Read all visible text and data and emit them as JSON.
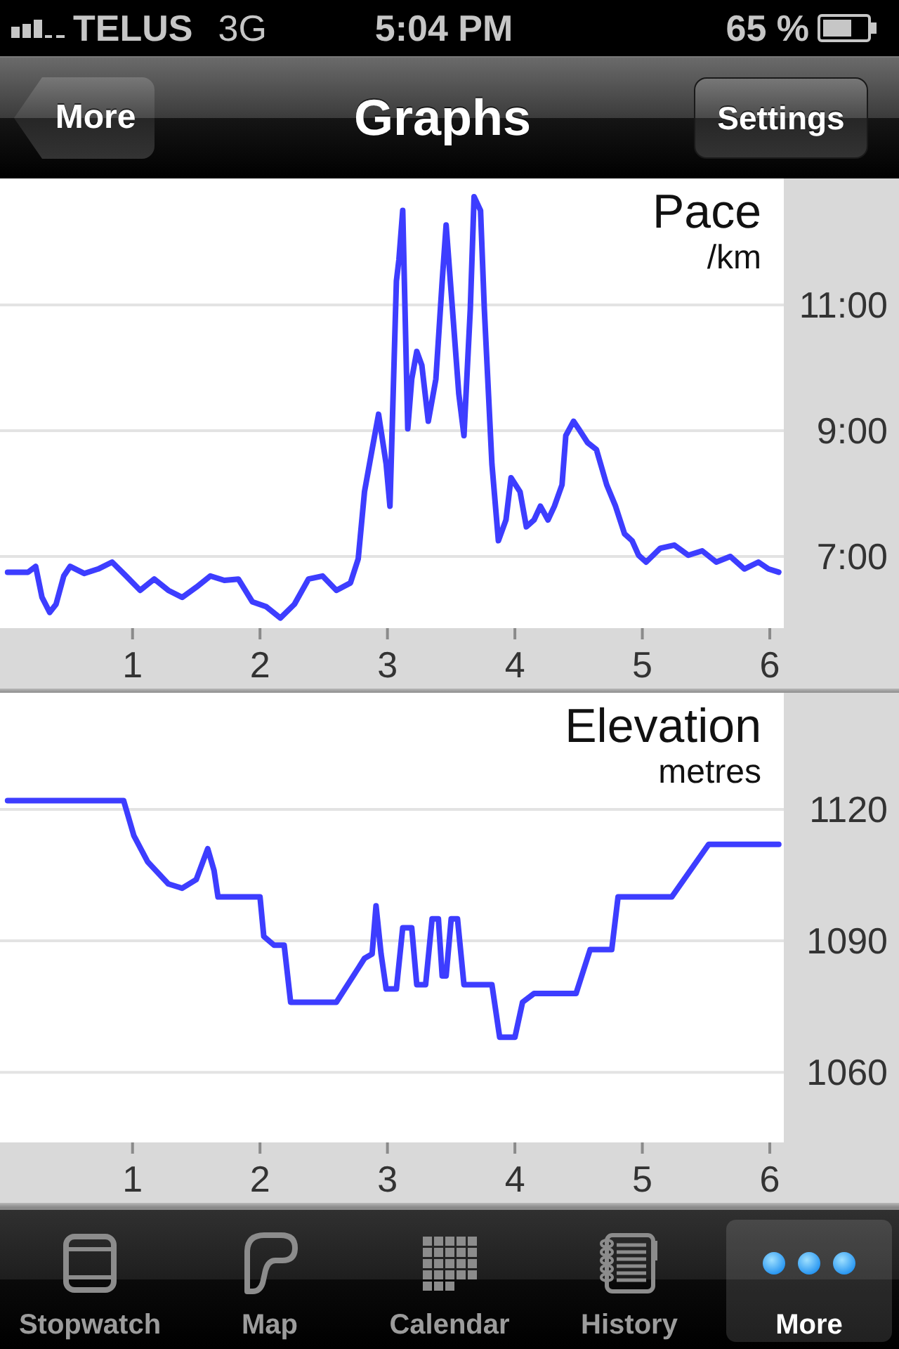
{
  "status_bar": {
    "carrier": "TELUS",
    "network": "3G",
    "time": "5:04 PM",
    "battery": "65 %"
  },
  "nav_bar": {
    "back_button": "More",
    "title": "Graphs",
    "right_button": "Settings"
  },
  "charts": [
    {
      "chart_data": {
        "type": "line",
        "title": "Pace",
        "ylabel": "/km",
        "grid": true,
        "xlim": [
          -0.04,
          6.11
        ],
        "ylim": [
          5.86,
          13.01
        ],
        "xticks": [
          1,
          2,
          3,
          4,
          5,
          6
        ],
        "yticks": [
          {
            "value": 7,
            "label": "7:00"
          },
          {
            "value": 9,
            "label": "9:00"
          },
          {
            "value": 11,
            "label": "11:00"
          }
        ],
        "x": [
          0.02,
          0.18,
          0.24,
          0.29,
          0.35,
          0.4,
          0.46,
          0.51,
          0.62,
          0.73,
          0.84,
          0.95,
          1.06,
          1.17,
          1.28,
          1.39,
          1.5,
          1.61,
          1.72,
          1.83,
          1.94,
          2.05,
          2.16,
          2.27,
          2.38,
          2.49,
          2.6,
          2.71,
          2.77,
          2.82,
          2.88,
          2.93,
          2.99,
          3.02,
          3.07,
          3.09,
          3.12,
          3.16,
          3.19,
          3.23,
          3.27,
          3.32,
          3.38,
          3.43,
          3.46,
          3.51,
          3.56,
          3.6,
          3.65,
          3.68,
          3.73,
          3.76,
          3.82,
          3.87,
          3.93,
          3.97,
          4.04,
          4.09,
          4.15,
          4.2,
          4.26,
          4.31,
          4.37,
          4.4,
          4.46,
          4.5,
          4.57,
          4.64,
          4.72,
          4.79,
          4.86,
          4.92,
          4.97,
          5.03,
          5.14,
          5.25,
          5.36,
          5.47,
          5.58,
          5.69,
          5.8,
          5.91,
          5.99,
          6.07
        ],
        "values": [
          6.75,
          6.75,
          6.84,
          6.35,
          6.11,
          6.24,
          6.69,
          6.84,
          6.73,
          6.8,
          6.91,
          6.69,
          6.46,
          6.64,
          6.46,
          6.35,
          6.51,
          6.69,
          6.62,
          6.64,
          6.28,
          6.2,
          6.02,
          6.24,
          6.64,
          6.69,
          6.46,
          6.58,
          6.96,
          8.03,
          8.7,
          9.26,
          8.47,
          7.8,
          11.38,
          11.72,
          12.5,
          9.03,
          9.82,
          10.26,
          10.04,
          9.15,
          9.82,
          11.38,
          12.27,
          10.93,
          9.59,
          8.92,
          10.93,
          12.72,
          12.5,
          10.93,
          8.47,
          7.25,
          7.58,
          8.25,
          8.03,
          7.47,
          7.58,
          7.8,
          7.58,
          7.8,
          8.14,
          8.92,
          9.15,
          9.03,
          8.81,
          8.7,
          8.14,
          7.8,
          7.36,
          7.25,
          7.02,
          6.91,
          7.13,
          7.18,
          7.02,
          7.09,
          6.91,
          7.0,
          6.8,
          6.91,
          6.8,
          6.75
        ]
      }
    },
    {
      "chart_data": {
        "type": "line",
        "title": "Elevation",
        "ylabel": "metres",
        "grid": true,
        "xlim": [
          -0.04,
          6.11
        ],
        "ylim": [
          1044,
          1146.6
        ],
        "xticks": [
          1,
          2,
          3,
          4,
          5,
          6
        ],
        "yticks": [
          1060,
          1090,
          1120
        ],
        "x": [
          0.02,
          0.93,
          1.01,
          1.12,
          1.28,
          1.39,
          1.5,
          1.59,
          1.64,
          1.67,
          2.0,
          2.03,
          2.11,
          2.19,
          2.24,
          2.6,
          2.82,
          2.88,
          2.91,
          2.95,
          2.99,
          3.07,
          3.12,
          3.19,
          3.23,
          3.3,
          3.35,
          3.4,
          3.43,
          3.46,
          3.5,
          3.55,
          3.6,
          3.82,
          3.88,
          4.0,
          4.06,
          4.15,
          4.48,
          4.59,
          4.76,
          4.81,
          5.23,
          5.52,
          6.07
        ],
        "values": [
          1122,
          1122,
          1114,
          1108,
          1103,
          1102,
          1104,
          1111,
          1106,
          1100,
          1100,
          1091,
          1089,
          1089,
          1076,
          1076,
          1086,
          1087,
          1098,
          1087,
          1079,
          1079,
          1093,
          1093,
          1080,
          1080,
          1095,
          1095,
          1082,
          1082,
          1095,
          1095,
          1080,
          1080,
          1068,
          1068,
          1076,
          1078,
          1078,
          1088,
          1088,
          1100,
          1100,
          1112,
          1112
        ]
      }
    }
  ],
  "tab_bar": [
    {
      "label": "Stopwatch",
      "kind": "stopwatch",
      "selected": false
    },
    {
      "label": "Map",
      "kind": "map",
      "selected": false
    },
    {
      "label": "Calendar",
      "kind": "calendar",
      "selected": false
    },
    {
      "label": "History",
      "kind": "history",
      "selected": false
    },
    {
      "label": "More",
      "kind": "more",
      "selected": true
    }
  ]
}
